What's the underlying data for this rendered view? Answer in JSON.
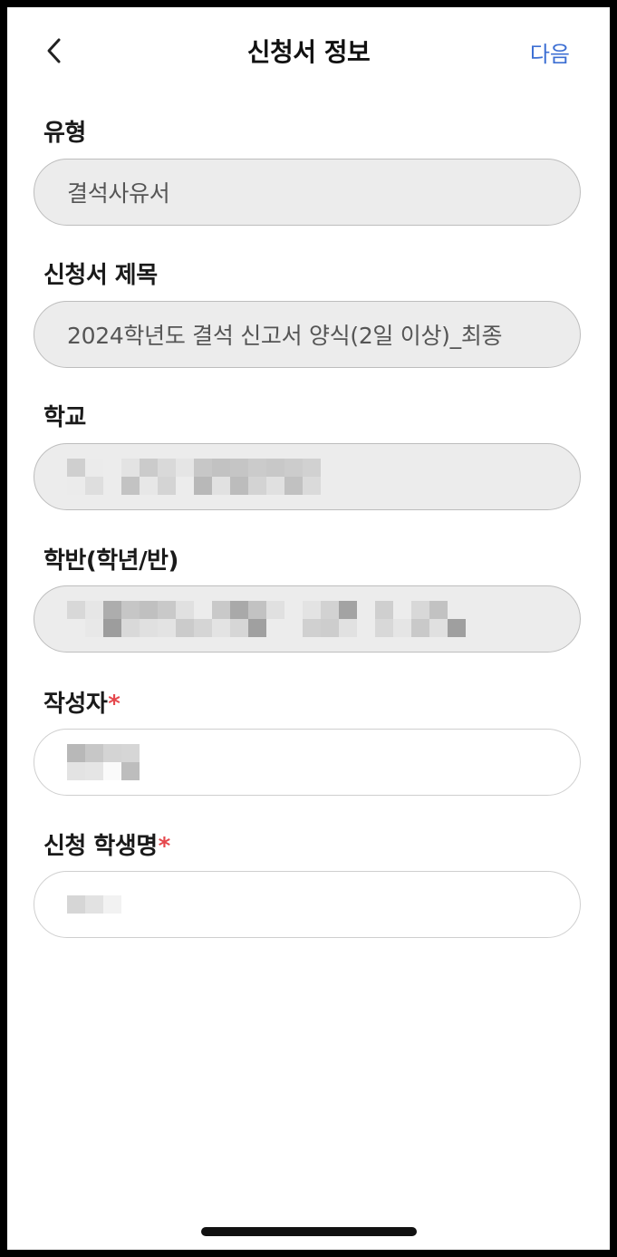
{
  "header": {
    "title": "신청서 정보",
    "next_label": "다음",
    "back_icon": "chevron-left-icon",
    "accent_color": "#3d6fd3"
  },
  "form": {
    "type": {
      "label": "유형",
      "value": "결석사유서"
    },
    "title": {
      "label": "신청서 제목",
      "value": "2024학년도 결석 신고서 양식(2일 이상)_최종"
    },
    "school": {
      "label": "학교",
      "value": ""
    },
    "class": {
      "label": "학반(학년/반)",
      "value": ""
    },
    "author": {
      "label": "작성자",
      "required_mark": "*",
      "value": ""
    },
    "student": {
      "label": "신청 학생명",
      "required_mark": "*",
      "value": ""
    }
  },
  "colors": {
    "required": "#e5484d",
    "readonly_field_bg": "#ececec",
    "editable_field_bg": "#ffffff"
  }
}
